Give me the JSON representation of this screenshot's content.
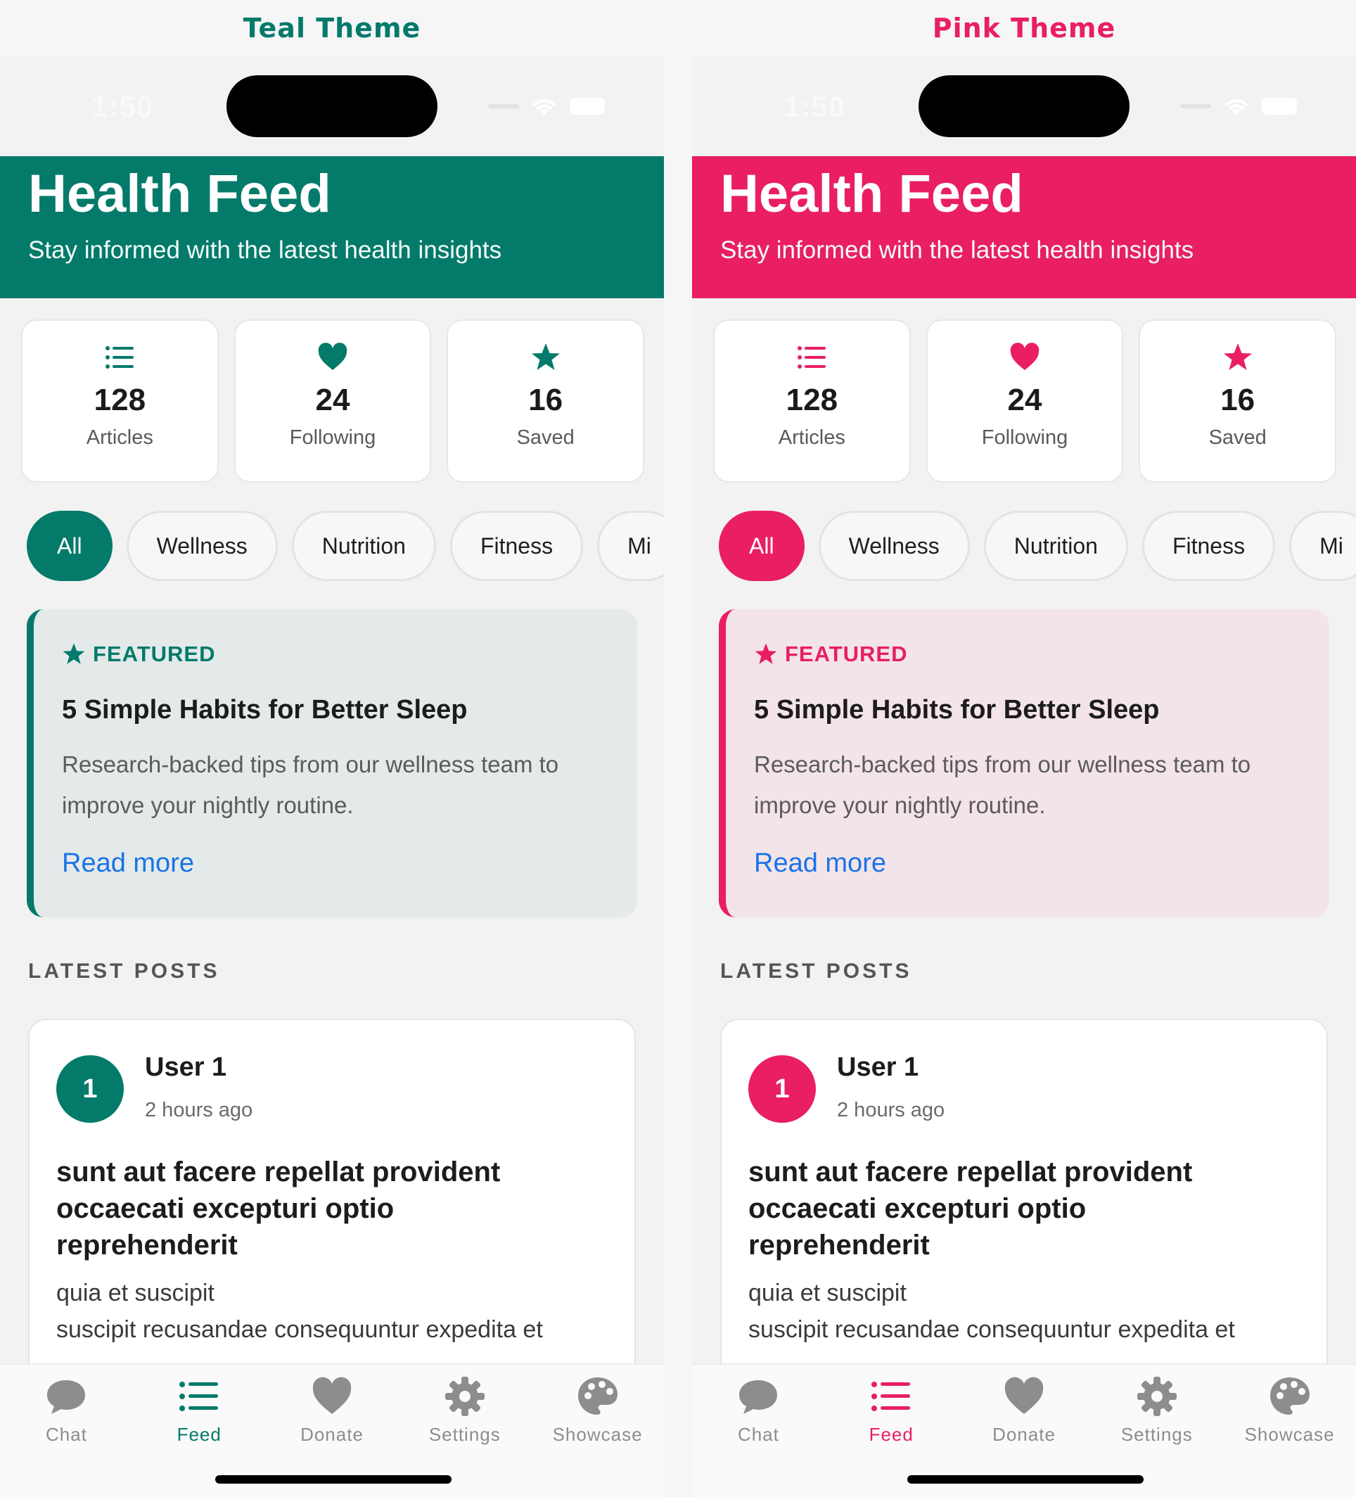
{
  "themes": [
    {
      "title": "Teal Theme",
      "accent": "#047a6a",
      "status": {
        "time": "1:50"
      },
      "header": {
        "title": "Health Feed",
        "subtitle": "Stay informed with the latest health insights"
      },
      "stats": [
        {
          "icon": "list-icon",
          "value": "128",
          "label": "Articles"
        },
        {
          "icon": "heart-icon",
          "value": "24",
          "label": "Following"
        },
        {
          "icon": "star-icon",
          "value": "16",
          "label": "Saved"
        }
      ],
      "chips": [
        "All",
        "Wellness",
        "Nutrition",
        "Fitness",
        "Mi"
      ],
      "featured": {
        "tag": "FEATURED",
        "title": "5 Simple Habits for Better Sleep",
        "description": "Research-backed tips from our wellness team to improve your nightly routine.",
        "link": "Read more"
      },
      "section_label": "LATEST POSTS",
      "post": {
        "avatar": "1",
        "user": "User 1",
        "time": "2 hours ago",
        "title": "sunt aut facere repellat provident occaecati excepturi optio reprehenderit",
        "body_line1": "quia et suscipit",
        "body_line2": "suscipit recusandae consequuntur expedita et"
      },
      "tabs": [
        {
          "icon": "chat-icon",
          "label": "Chat"
        },
        {
          "icon": "feed-icon",
          "label": "Feed"
        },
        {
          "icon": "heart-icon",
          "label": "Donate"
        },
        {
          "icon": "gear-icon",
          "label": "Settings"
        },
        {
          "icon": "palette-icon",
          "label": "Showcase"
        }
      ],
      "active_tab": "Feed"
    },
    {
      "title": "Pink Theme",
      "accent": "#e91e63",
      "status": {
        "time": "1:50"
      },
      "header": {
        "title": "Health Feed",
        "subtitle": "Stay informed with the latest health insights"
      },
      "stats": [
        {
          "icon": "list-icon",
          "value": "128",
          "label": "Articles"
        },
        {
          "icon": "heart-icon",
          "value": "24",
          "label": "Following"
        },
        {
          "icon": "star-icon",
          "value": "16",
          "label": "Saved"
        }
      ],
      "chips": [
        "All",
        "Wellness",
        "Nutrition",
        "Fitness",
        "Mi"
      ],
      "featured": {
        "tag": "FEATURED",
        "title": "5 Simple Habits for Better Sleep",
        "description": "Research-backed tips from our wellness team to improve your nightly routine.",
        "link": "Read more"
      },
      "section_label": "LATEST POSTS",
      "post": {
        "avatar": "1",
        "user": "User 1",
        "time": "2 hours ago",
        "title": "sunt aut facere repellat provident occaecati excepturi optio reprehenderit",
        "body_line1": "quia et suscipit",
        "body_line2": "suscipit recusandae consequuntur expedita et"
      },
      "tabs": [
        {
          "icon": "chat-icon",
          "label": "Chat"
        },
        {
          "icon": "feed-icon",
          "label": "Feed"
        },
        {
          "icon": "heart-icon",
          "label": "Donate"
        },
        {
          "icon": "gear-icon",
          "label": "Settings"
        },
        {
          "icon": "palette-icon",
          "label": "Showcase"
        }
      ],
      "active_tab": "Feed"
    }
  ]
}
